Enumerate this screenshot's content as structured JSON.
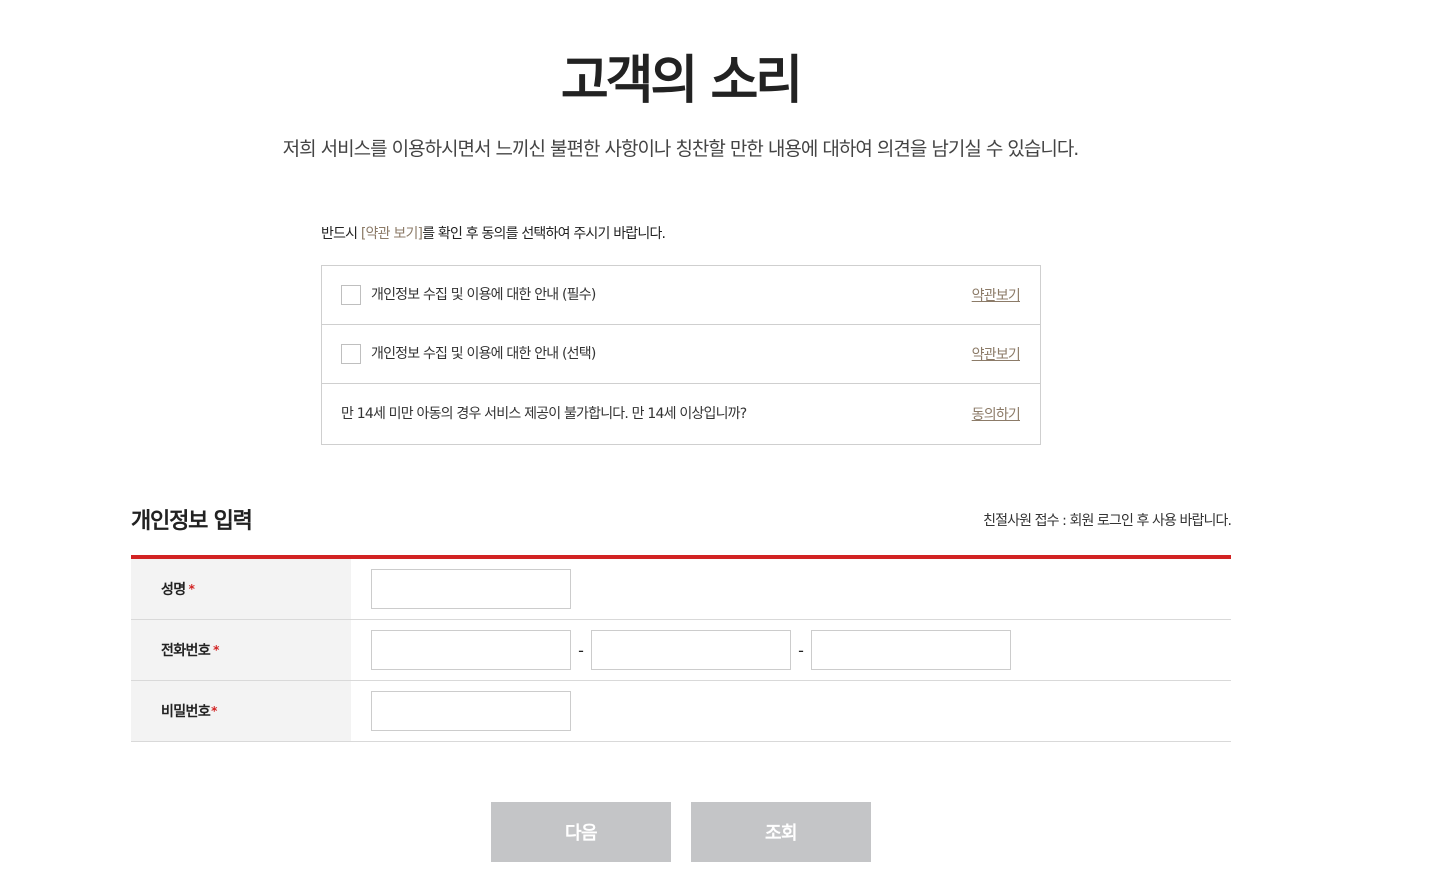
{
  "header": {
    "title": "고객의 소리",
    "subtitle": "저희 서비스를 이용하시면서 느끼신 불편한 사항이나 칭찬할 만한 내용에 대하여 의견을 남기실 수 있습니다."
  },
  "notice": {
    "prefix": "반드시 ",
    "terms_link": "[약관 보기]",
    "suffix": "를 확인 후 동의를 선택하여 주시기 바랍니다."
  },
  "agreements": [
    {
      "label": "개인정보 수집 및 이용에 대한 안내 (필수)",
      "link": "약관보기",
      "has_checkbox": true
    },
    {
      "label": "개인정보 수집 및 이용에 대한 안내 (선택)",
      "link": "약관보기",
      "has_checkbox": true
    },
    {
      "label": "만 14세 미만 아동의 경우 서비스 제공이 불가합니다. 만 14세 이상입니까?",
      "link": "동의하기",
      "has_checkbox": false
    }
  ],
  "section": {
    "title": "개인정보 입력",
    "note": "친절사원 접수 : 회원 로그인 후 사용 바랍니다."
  },
  "form": {
    "name_label": "성명",
    "phone_label": "전화번호",
    "password_label": "비밀번호",
    "required_mark": "*",
    "phone_separator": "-",
    "name_value": "",
    "phone1_value": "",
    "phone2_value": "",
    "phone3_value": "",
    "password_value": ""
  },
  "buttons": {
    "next": "다음",
    "query": "조회"
  },
  "colors": {
    "accent_red": "#d22323",
    "link_brown": "#8c7b68",
    "button_gray": "#c4c5c7",
    "label_bg": "#f3f3f3"
  }
}
